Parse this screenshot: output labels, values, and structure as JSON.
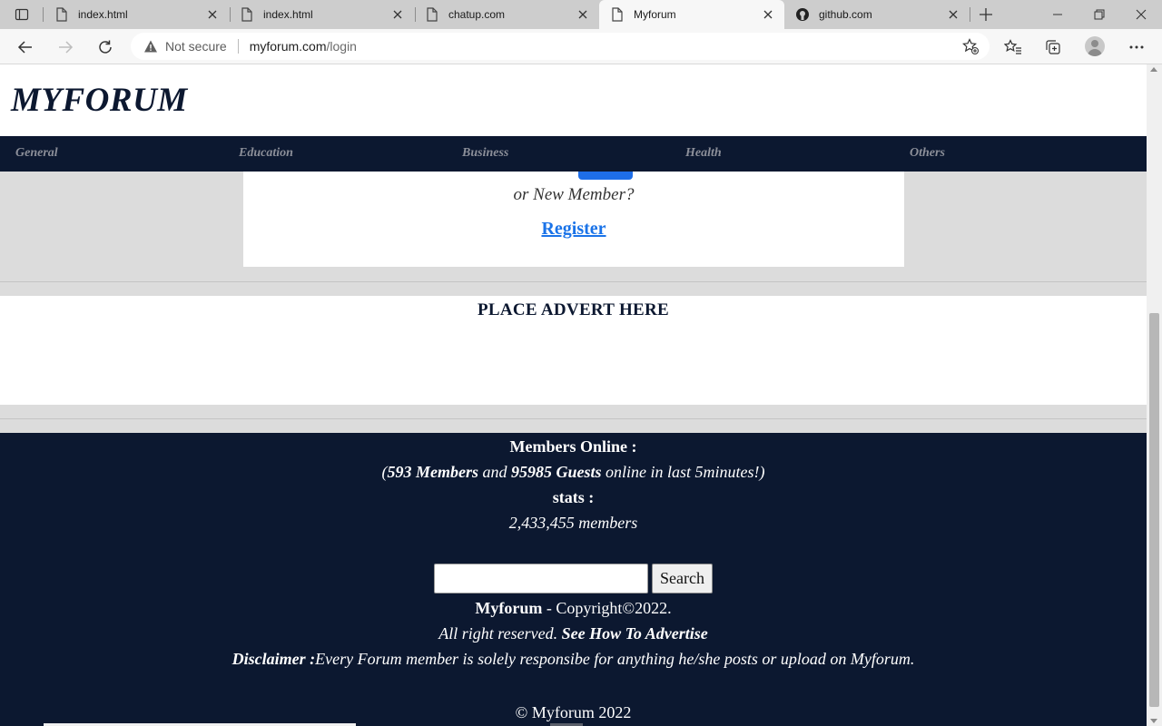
{
  "browser": {
    "tabs": [
      {
        "title": "index.html",
        "icon": "page-icon"
      },
      {
        "title": "index.html",
        "icon": "page-icon"
      },
      {
        "title": "chatup.com",
        "icon": "page-icon"
      },
      {
        "title": "Myforum",
        "icon": "page-icon",
        "active": true
      },
      {
        "title": "github.com",
        "icon": "github-icon"
      }
    ],
    "security_label": "Not secure",
    "url_host": "myforum.com",
    "url_path": "/login"
  },
  "site": {
    "logo": "MYFORUM",
    "categories": [
      "General",
      "Education",
      "Business",
      "Health",
      "Others"
    ]
  },
  "login": {
    "new_member_text": "or New Member?",
    "register_link": "Register"
  },
  "advert": {
    "title": "PLACE ADVERT HERE"
  },
  "footer": {
    "members_online_label": "Members Online :",
    "open_paren": "(",
    "members_count": "593 Members",
    "and_text": " and ",
    "guests_count": "95985 Guests",
    "online_suffix": " online in last 5minutes!)",
    "stats_label": "stats :",
    "total_members": "2,433,455 members",
    "search_button": "Search",
    "brand": "Myforum",
    "copyright": " - Copyright©2022.",
    "rights": "All right reserved. ",
    "advertise_link": "See How To Advertise",
    "disclaimer_label": "Disclaimer :",
    "disclaimer_text": "Every Forum member is solely responsibe for anything he/she posts or upload on Myforum.",
    "bottom_copyright": "© Myforum 2022"
  },
  "colors": {
    "navy": "#0c1830",
    "link_blue": "#1a73e8",
    "category_gray": "#8c8f99",
    "page_gray": "#dcdcdc"
  }
}
